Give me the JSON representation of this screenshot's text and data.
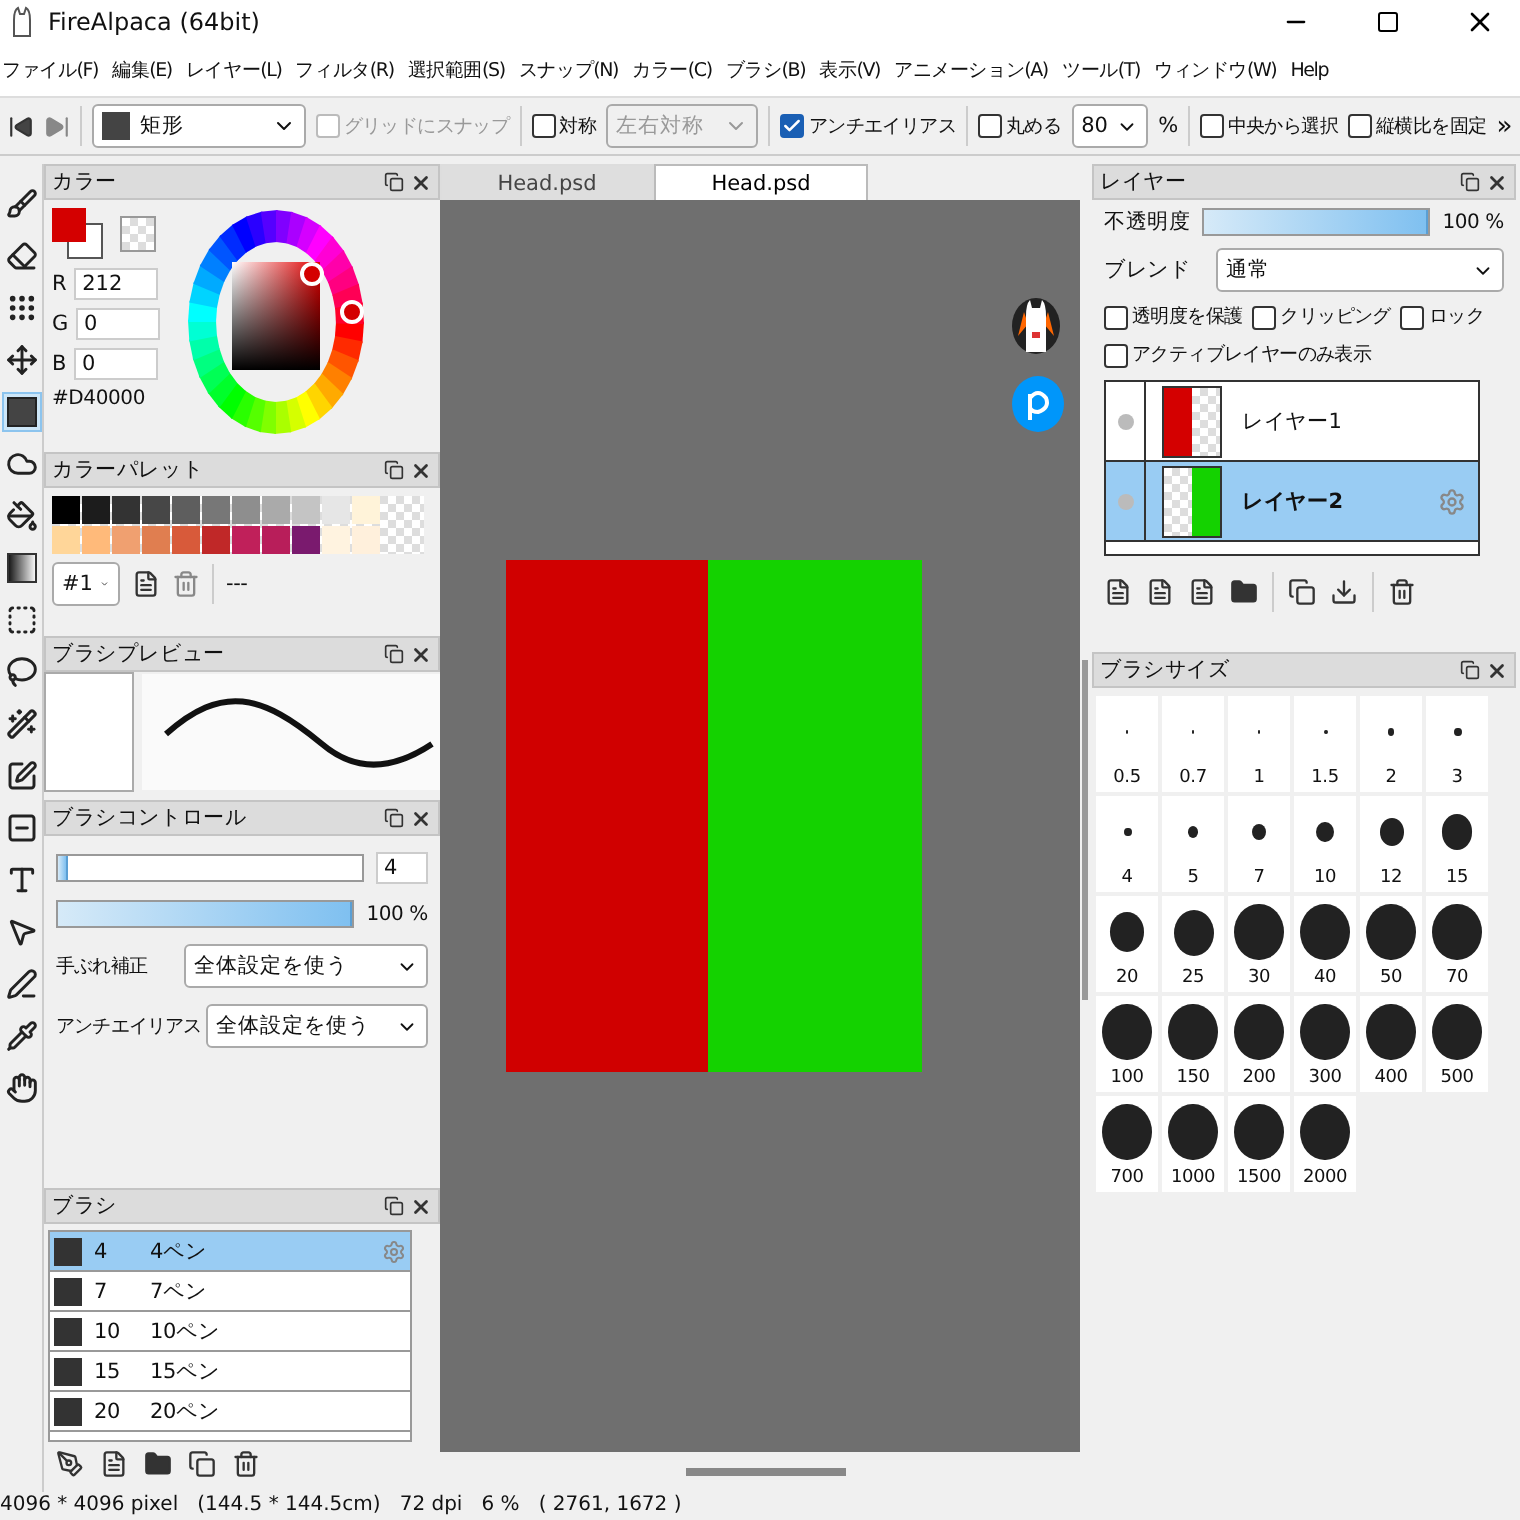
{
  "window": {
    "title": "FireAlpaca (64bit)"
  },
  "menu": [
    "ファイル(F)",
    "編集(E)",
    "レイヤー(L)",
    "フィルタ(R)",
    "選択範囲(S)",
    "スナップ(N)",
    "カラー(C)",
    "ブラシ(B)",
    "表示(V)",
    "アニメーション(A)",
    "ツール(T)",
    "ウィンドウ(W)",
    "Help"
  ],
  "toolbar": {
    "shape": "矩形",
    "grid_snap": {
      "label": "グリッドにスナップ",
      "checked": false,
      "disabled": true
    },
    "symmetry": {
      "label": "対称",
      "checked": false
    },
    "symmetry_mode": {
      "value": "左右対称",
      "disabled": true
    },
    "antialias": {
      "label": "アンチエイリアス",
      "checked": true
    },
    "round": {
      "label": "丸める",
      "checked": false
    },
    "round_value": "80",
    "round_unit": "%",
    "center_select": {
      "label": "中央から選択",
      "checked": false
    },
    "fix_ratio": {
      "label": "縦横比を固定",
      "checked": false
    },
    "more": "»"
  },
  "tools": [
    {
      "kind": "brush",
      "selected": false
    },
    {
      "kind": "eraser",
      "selected": false
    },
    {
      "kind": "dots",
      "selected": false
    },
    {
      "kind": "move",
      "selected": false
    },
    {
      "kind": "shape",
      "selected": true
    },
    {
      "kind": "blob",
      "selected": false
    },
    {
      "kind": "bucket",
      "selected": false
    },
    {
      "kind": "gradient",
      "selected": false
    },
    {
      "kind": "select",
      "selected": false
    },
    {
      "kind": "lasso",
      "selected": false
    },
    {
      "kind": "wand",
      "selected": false
    },
    {
      "kind": "selpen",
      "selected": false
    },
    {
      "kind": "selerase",
      "selected": false
    },
    {
      "kind": "text",
      "selected": false
    },
    {
      "kind": "pointer",
      "selected": false
    },
    {
      "kind": "pen",
      "selected": false
    },
    {
      "kind": "pipette",
      "selected": false
    },
    {
      "kind": "hand",
      "selected": false
    }
  ],
  "color_panel": {
    "title": "カラー",
    "channels": [
      {
        "label": "R",
        "value": "212"
      },
      {
        "label": "G",
        "value": "0"
      },
      {
        "label": "B",
        "value": "0"
      }
    ],
    "hex": "#D40000"
  },
  "palette": {
    "title": "カラーパレット",
    "colors": [
      {
        "color": "#000000"
      },
      {
        "color": "#1c1c1c"
      },
      {
        "color": "#333333"
      },
      {
        "color": "#474747"
      },
      {
        "color": "#5e5e5e"
      },
      {
        "color": "#777777"
      },
      {
        "color": "#8e8e8e"
      },
      {
        "color": "#aaaaaa"
      },
      {
        "color": "#c4c4c4"
      },
      {
        "color": "#e6e6e6"
      },
      {
        "color": "#fff3d9"
      },
      {
        "color": "#ffd699"
      },
      {
        "color": "#ffba7a"
      },
      {
        "color": "#f0a070"
      },
      {
        "color": "#e07e50"
      },
      {
        "color": "#d85a3a"
      },
      {
        "color": "#c02828"
      },
      {
        "color": "#c0205a"
      },
      {
        "color": "#b81e5a"
      },
      {
        "color": "#7a1a6e"
      },
      {
        "color": "#fff3e0"
      },
      {
        "color": "#fff0dc"
      }
    ],
    "set": "#1",
    "name": "---"
  },
  "brush_preview": {
    "title": "ブラシプレビュー"
  },
  "brush_control": {
    "title": "ブラシコントロール",
    "size": {
      "level": 0.03,
      "value": "4"
    },
    "opacity": {
      "level": 1,
      "reading": "100 %"
    },
    "stabilizer": {
      "label": "手ぶれ補正",
      "value": "全体設定を使う"
    },
    "antialias": {
      "label": "アンチエイリアス",
      "value": "全体設定を使う"
    }
  },
  "brushes": {
    "title": "ブラシ",
    "items": [
      {
        "size": "4",
        "name": "4ペン",
        "selected": true
      },
      {
        "size": "7",
        "name": "7ペン",
        "selected": false
      },
      {
        "size": "10",
        "name": "10ペン",
        "selected": false
      },
      {
        "size": "15",
        "name": "15ペン",
        "selected": false
      },
      {
        "size": "20",
        "name": "20ペン",
        "selected": false
      }
    ]
  },
  "canvas_tabs": [
    {
      "label": "Head.psd",
      "selected": false
    },
    {
      "label": "Head.psd",
      "selected": true
    }
  ],
  "layers": {
    "title": "レイヤー",
    "opacity": {
      "label": "不透明度",
      "level": 1,
      "reading": "100 %"
    },
    "blend": {
      "label": "ブレンド",
      "value": "通常"
    },
    "options": [
      {
        "label": "透明度を保護",
        "checked": false
      },
      {
        "label": "クリッピング",
        "checked": false
      },
      {
        "label": "ロック",
        "checked": false
      },
      {
        "label": "アクティブレイヤーのみ表示",
        "checked": false
      }
    ],
    "items": [
      {
        "name": "レイヤー1",
        "selected": false,
        "color": "#d40000"
      },
      {
        "name": "レイヤー2",
        "selected": true,
        "color": "#14d200"
      }
    ]
  },
  "brush_sizes": {
    "title": "ブラシサイズ",
    "items": [
      "0.5",
      "0.7",
      "1",
      "1.5",
      "2",
      "3",
      "4",
      "5",
      "7",
      "10",
      "12",
      "15",
      "20",
      "25",
      "30",
      "40",
      "50",
      "70",
      "100",
      "150",
      "200",
      "300",
      "400",
      "500",
      "700",
      "1000",
      "1500",
      "2000"
    ]
  },
  "status_bar": "4096 * 4096 pixel   (144.5 * 144.5cm)   72 dpi   6 %   ( 2761, 1672 )"
}
